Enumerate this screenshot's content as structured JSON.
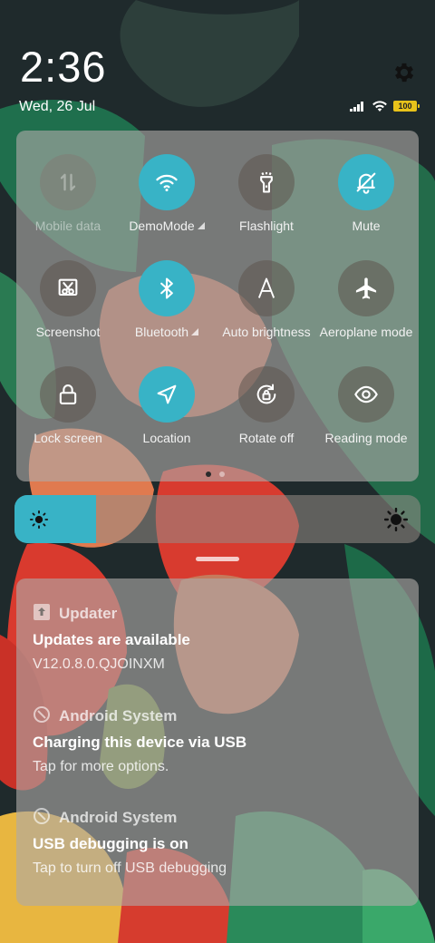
{
  "status": {
    "time": "2:36",
    "date": "Wed, 26 Jul",
    "battery": "100"
  },
  "quick_settings": {
    "tiles": [
      {
        "label": "Mobile data",
        "icon": "mobile-data-icon",
        "state": "off",
        "expandable": false
      },
      {
        "label": "DemoMode",
        "icon": "wifi-icon",
        "state": "on",
        "expandable": true
      },
      {
        "label": "Flashlight",
        "icon": "flashlight-icon",
        "state": "normal",
        "expandable": false
      },
      {
        "label": "Mute",
        "icon": "bell-off-icon",
        "state": "on",
        "expandable": false
      },
      {
        "label": "Screenshot",
        "icon": "screenshot-icon",
        "state": "normal",
        "expandable": false
      },
      {
        "label": "Bluetooth",
        "icon": "bluetooth-icon",
        "state": "on",
        "expandable": true
      },
      {
        "label": "Auto brightness",
        "icon": "auto-brightness-icon",
        "state": "normal",
        "expandable": false
      },
      {
        "label": "Aeroplane mode",
        "icon": "airplane-icon",
        "state": "normal",
        "expandable": false
      },
      {
        "label": "Lock screen",
        "icon": "lock-icon",
        "state": "normal",
        "expandable": false
      },
      {
        "label": "Location",
        "icon": "location-icon",
        "state": "on",
        "expandable": false
      },
      {
        "label": "Rotate off",
        "icon": "rotate-lock-icon",
        "state": "normal",
        "expandable": false
      },
      {
        "label": "Reading mode",
        "icon": "eye-icon",
        "state": "normal",
        "expandable": false
      }
    ],
    "pages": 2,
    "current_page": 1
  },
  "brightness": {
    "level": 0.2
  },
  "notifications": [
    {
      "app": "Updater",
      "app_icon": "updater-icon",
      "title": "Updates are available",
      "body": "V12.0.8.0.QJOINXM"
    },
    {
      "app": "Android System",
      "app_icon": "android-system-icon",
      "title": "Charging this device via USB",
      "body": "Tap for more options."
    },
    {
      "app": "Android System",
      "app_icon": "android-system-icon",
      "title": "USB debugging is on",
      "body": "Tap to turn off USB debugging"
    }
  ],
  "colors": {
    "accent": "#38b3c6",
    "battery": "#e8c21a"
  }
}
